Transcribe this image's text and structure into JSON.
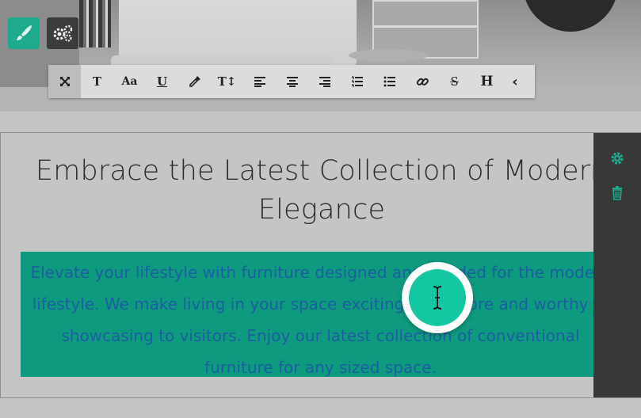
{
  "toolbar": {
    "items": [
      {
        "name": "fullscreen-icon",
        "glyph": "⤧"
      },
      {
        "name": "text-style-icon",
        "glyph": "T"
      },
      {
        "name": "font-icon",
        "glyph": "Aa"
      },
      {
        "name": "underline-icon",
        "glyph": "U"
      },
      {
        "name": "color-picker-icon",
        "glyph": "✎"
      },
      {
        "name": "text-size-icon",
        "glyph": "T↕"
      },
      {
        "name": "align-left-icon",
        "glyph": "≡"
      },
      {
        "name": "align-center-icon",
        "glyph": "≡"
      },
      {
        "name": "align-right-icon",
        "glyph": "≡"
      },
      {
        "name": "ordered-list-icon",
        "glyph": "⋮≡"
      },
      {
        "name": "unordered-list-icon",
        "glyph": "•≡"
      },
      {
        "name": "link-icon",
        "glyph": "🔗"
      },
      {
        "name": "strikethrough-icon",
        "glyph": "S"
      },
      {
        "name": "heading-icon",
        "glyph": "H"
      },
      {
        "name": "collapse-icon",
        "glyph": "‹"
      }
    ]
  },
  "section": {
    "title": "Embrace the Latest Collection of Modern Elegance",
    "paragraph": "Elevate your lifestyle with furniture designed and molded for the modern lifestyle. We make living in your space exciting once more and worthy of showcasing to visitors. Enjoy our latest collection of conventional furniture for any sized space."
  },
  "colors": {
    "accent": "#1eaa8c",
    "selection": "#0e9a7e",
    "paragraph_text": "#1c5fa0",
    "panel": "#383838"
  }
}
